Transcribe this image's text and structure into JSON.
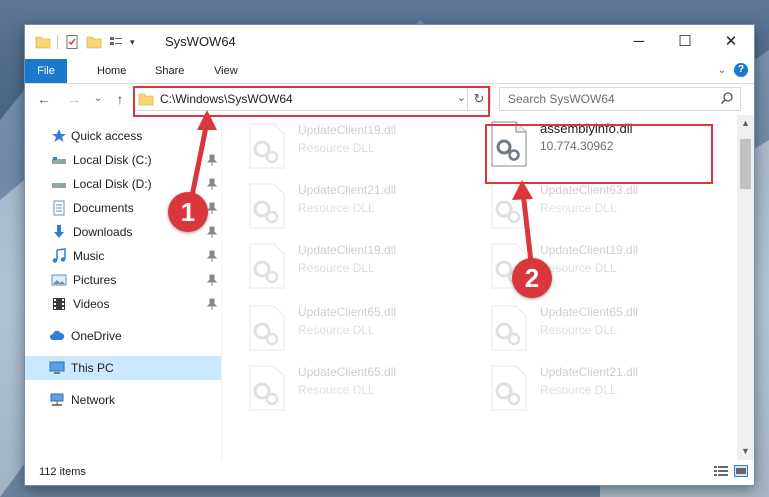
{
  "window": {
    "title": "SysWOW64",
    "controls": {
      "minimize": "─",
      "maximize": "☐",
      "close": "✕"
    }
  },
  "ribbon": {
    "tabs": [
      "File",
      "Home",
      "Share",
      "View"
    ],
    "expand_icon": "chevron-down-icon",
    "help_label": "?"
  },
  "navigation": {
    "back": "←",
    "forward": "→",
    "recent": "⌄",
    "up": "↑",
    "address": "C:\\Windows\\SysWOW64",
    "search_placeholder": "Search SysWOW64"
  },
  "sidebar": {
    "items": [
      {
        "label": "Quick access",
        "icon": "star-icon",
        "pinned": false
      },
      {
        "label": "Local Disk (C:)",
        "icon": "drive-icon",
        "pinned": true
      },
      {
        "label": "Local Disk (D:)",
        "icon": "drive-icon",
        "pinned": true
      },
      {
        "label": "Documents",
        "icon": "documents-icon",
        "pinned": true
      },
      {
        "label": "Downloads",
        "icon": "download-icon",
        "pinned": true
      },
      {
        "label": "Music",
        "icon": "music-icon",
        "pinned": true
      },
      {
        "label": "Pictures",
        "icon": "pictures-icon",
        "pinned": true
      },
      {
        "label": "Videos",
        "icon": "videos-icon",
        "pinned": true
      },
      {
        "label": "OneDrive",
        "icon": "cloud-icon",
        "pinned": false
      },
      {
        "label": "This PC",
        "icon": "computer-icon",
        "pinned": false,
        "selected": true
      },
      {
        "label": "Network",
        "icon": "network-icon",
        "pinned": false
      }
    ]
  },
  "files": [
    {
      "name": "UpdateClient19.dll",
      "type": "Resource DLL",
      "faded": true
    },
    {
      "name": "assemblyinfo.dll",
      "type": "10.774.30962",
      "faded": false
    },
    {
      "name": "UpdateClient21.dll",
      "type": "Resource DLL",
      "faded": true
    },
    {
      "name": "UpdateClient63.dll",
      "type": "Resource DLL",
      "faded": true
    },
    {
      "name": "UpdateClient19.dll",
      "type": "Resource DLL",
      "faded": true
    },
    {
      "name": "UpdateClient19.dll",
      "type": "Resource DLL",
      "faded": true
    },
    {
      "name": "UpdateClient65.dll",
      "type": "Resource DLL",
      "faded": true
    },
    {
      "name": "UpdateClient65.dll",
      "type": "Resource DLL",
      "faded": true
    },
    {
      "name": "UpdateClient65.dll",
      "type": "Resource DLL",
      "faded": true
    },
    {
      "name": "UpdateClient21.dll",
      "type": "Resource DLL",
      "faded": true
    }
  ],
  "status": {
    "item_count": "112 items"
  },
  "annotations": {
    "callout_1": "1",
    "callout_2": "2",
    "color": "#d9363e"
  },
  "colors": {
    "accent": "#1979ca",
    "selected": "#cce8ff",
    "folder": "#f8d775"
  }
}
